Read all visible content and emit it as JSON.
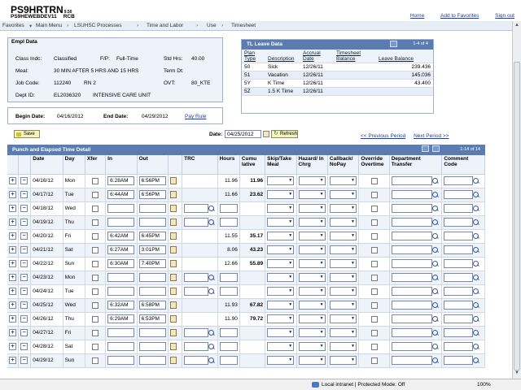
{
  "header": {
    "app_code": "PS9HRTRN",
    "version": "9.50",
    "db": "PS9HEWEBDEV11",
    "user": "RCB",
    "links": [
      "Home",
      "Add to Favorites",
      "Sign out"
    ]
  },
  "nav": [
    "Favorites",
    "Main Menu",
    "LSUHSC Processes",
    "Time and Labor",
    "Use",
    "Timesheet"
  ],
  "empl": {
    "title": "Empl Data",
    "class_indc_label": "Class Indc:",
    "class_indc": "Classified",
    "fp_label": "F/P:",
    "fp": "Full-Time",
    "std_hrs_label": "Std Hrs:",
    "std_hrs": "40.00",
    "meal_label": "Meal:",
    "meal": "30 MIN AFTER 5 HRS AND 15 HRS",
    "term_label": "Term Dt:",
    "job_code_label": "Job Code:",
    "job_code": "112240",
    "job_title": "RN 2",
    "ovt_label": "OVT:",
    "ovt": "80_KTE",
    "dept_label": "Dept ID:",
    "dept_id": "EL2036320",
    "dept_name": "INTENSIVE CARE UNIT"
  },
  "period": {
    "begin_label": "Begin Date:",
    "begin": "04/16/2012",
    "end_label": "End Date:",
    "end": "04/29/2012",
    "pay_rule": "Pay Rule"
  },
  "leave": {
    "title": "TL Leave Data",
    "count": "1-4 of 4",
    "headers": [
      "Plan Type",
      "Description",
      "Accrual Date",
      "Timesheet Balance",
      "Leave Balance"
    ],
    "rows": [
      [
        "50",
        "Sick",
        "12/26/11",
        "",
        "239.436"
      ],
      [
        "51",
        "Vacation",
        "12/26/11",
        "",
        "145.036"
      ],
      [
        "5Y",
        "K Time",
        "12/26/11",
        "",
        "43.400"
      ],
      [
        "5Z",
        "1.5 K Time",
        "12/26/11",
        "",
        ""
      ]
    ]
  },
  "toolbar": {
    "save": "Save",
    "date_label": "Date:",
    "date_value": "04/25/2012",
    "refresh": "Refresh",
    "prev_period": "<< Previous Period",
    "next_period": "Next Period >>"
  },
  "grid": {
    "title": "Punch and Elapsed Time Detail",
    "count": "1-14 of 14",
    "headers": [
      "",
      "",
      "Date",
      "Day",
      "Xfer",
      "In",
      "Out",
      "",
      "TRC",
      "Hours",
      "Cumu lative",
      "Skip/Take Meal",
      "Hazard/ In Chrg",
      "Callback/ NoPay",
      "Override Overtime",
      "Department Transfer",
      "Comment Code"
    ],
    "rows": [
      {
        "date": "04/16/12",
        "day": "Mon",
        "in": "6:28AM",
        "out": "6:56PM",
        "hours": "11.96",
        "cumu": "11.96"
      },
      {
        "date": "04/17/12",
        "day": "Tue",
        "in": "6:44AM",
        "out": "6:56PM",
        "hours": "11.66",
        "cumu": "23.62"
      },
      {
        "date": "04/18/12",
        "day": "Wed",
        "in": "",
        "out": "",
        "hours": "",
        "cumu": ""
      },
      {
        "date": "04/19/12",
        "day": "Thu",
        "in": "",
        "out": "",
        "hours": "",
        "cumu": ""
      },
      {
        "date": "04/20/12",
        "day": "Fri",
        "in": "6:42AM",
        "out": "6:45PM",
        "hours": "11.55",
        "cumu": "35.17"
      },
      {
        "date": "04/21/12",
        "day": "Sat",
        "in": "6:27AM",
        "out": "3:01PM",
        "hours": "8.06",
        "cumu": "43.23"
      },
      {
        "date": "04/22/12",
        "day": "Sun",
        "in": "6:30AM",
        "out": "7:40PM",
        "hours": "12.66",
        "cumu": "55.89"
      },
      {
        "date": "04/23/12",
        "day": "Mon",
        "in": "",
        "out": "",
        "hours": "",
        "cumu": ""
      },
      {
        "date": "04/24/12",
        "day": "Tue",
        "in": "",
        "out": "",
        "hours": "",
        "cumu": ""
      },
      {
        "date": "04/25/12",
        "day": "Wed",
        "in": "6:32AM",
        "out": "6:58PM",
        "hours": "11.93",
        "cumu": "67.82"
      },
      {
        "date": "04/26/12",
        "day": "Thu",
        "in": "6:29AM",
        "out": "6:53PM",
        "hours": "11.90",
        "cumu": "79.72"
      },
      {
        "date": "04/27/12",
        "day": "Fri",
        "in": "",
        "out": "",
        "hours": "",
        "cumu": ""
      },
      {
        "date": "04/28/12",
        "day": "Sat",
        "in": "",
        "out": "",
        "hours": "",
        "cumu": ""
      },
      {
        "date": "04/29/12",
        "day": "Sun",
        "in": "",
        "out": "",
        "hours": "",
        "cumu": ""
      }
    ]
  },
  "status": {
    "zone": "Local intranet | Protected Mode: Off",
    "zoom": "100%"
  }
}
